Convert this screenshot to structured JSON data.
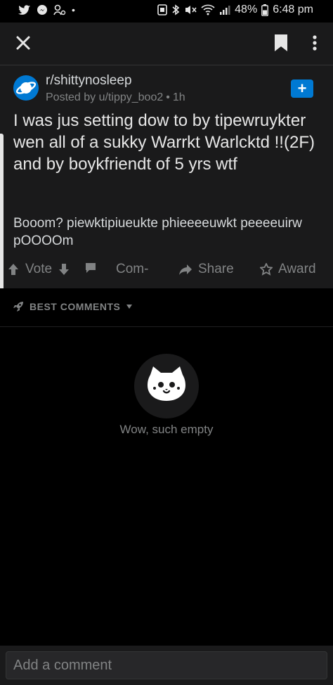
{
  "status_bar": {
    "battery": "48%",
    "time": "6:48 pm",
    "left_icons": [
      "twitter-icon",
      "messenger-icon",
      "link-icon",
      "dot-icon"
    ],
    "right_icons": [
      "nfc-icon",
      "bluetooth-icon",
      "mute-icon",
      "wifi-icon",
      "signal-icon",
      "battery-icon"
    ]
  },
  "app_bar": {
    "icons": [
      "close-icon",
      "bookmark-icon",
      "more-vertical-icon"
    ]
  },
  "post": {
    "subreddit": "r/shittynosleep",
    "author": "Posted by u/tippy_boo2",
    "separator": "•",
    "age": "1h",
    "join_label": "+",
    "title": "I was jus setting dow to by tipewruykter wen all of a sukky Warrkt Warlcktd !!(2F) and by boykfriendt of 5 yrs wtf",
    "body": "Booom? piewktipiueukte phieeeeuwkt peeeeuirw pOOOOm"
  },
  "actions": {
    "vote_label": "Vote",
    "comments_label": "Com-",
    "share_label": "Share",
    "award_label": "Award"
  },
  "comments": {
    "sort_label": "BEST COMMENTS",
    "empty_text": "Wow, such empty"
  },
  "comment_input": {
    "placeholder": "Add a comment"
  },
  "colors": {
    "background": "#000000",
    "card": "#1a1a1b",
    "accent": "#0079d3",
    "text": "#d7dadc",
    "muted": "#818384"
  }
}
